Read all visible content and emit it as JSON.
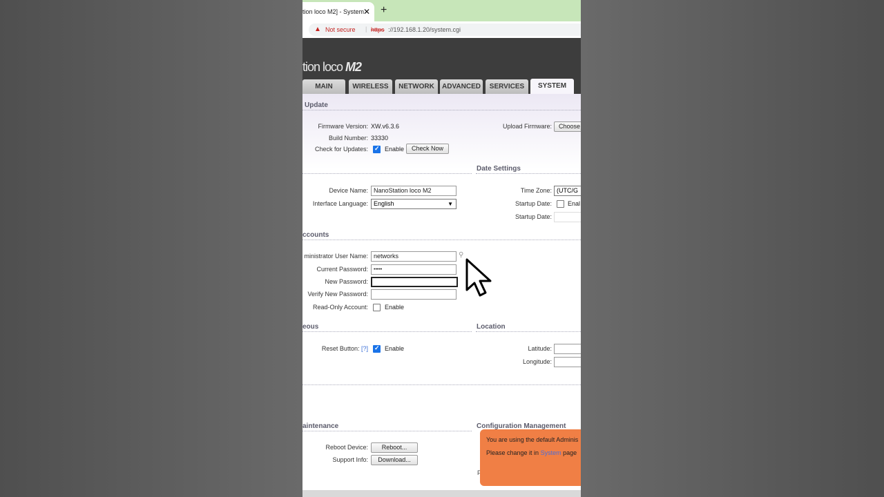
{
  "browser": {
    "tab_title": "tion loco M2] - System",
    "close_glyph": "✕",
    "new_tab_glyph": "+",
    "security_warning": "Not secure",
    "url_scheme": "https",
    "url_rest": "://192.168.1.20/system.cgi"
  },
  "header": {
    "logo_light": "tion loco ",
    "logo_bold": "M2",
    "tabs": [
      {
        "label": "MAIN"
      },
      {
        "label": "WIRELESS"
      },
      {
        "label": "NETWORK"
      },
      {
        "label": "ADVANCED"
      },
      {
        "label": "SERVICES"
      },
      {
        "label": "SYSTEM"
      }
    ]
  },
  "update": {
    "section": "Update",
    "firmware_label": "Firmware Version:",
    "firmware_value": "XW.v6.3.6",
    "build_label": "Build Number:",
    "build_value": "33330",
    "check_label": "Check for Updates:",
    "check_enable": "Enable",
    "check_now": "Check Now",
    "upload_label": "Upload Firmware:",
    "choose_button": "Choose"
  },
  "device": {
    "name_label": "Device Name:",
    "name_value": "NanoStation loco M2",
    "lang_label": "Interface Language:",
    "lang_value": "English"
  },
  "date": {
    "section": "Date Settings",
    "tz_label": "Time Zone:",
    "tz_value": "(UTC/G",
    "startup_label": "Startup Date:",
    "startup_enable": "Enal",
    "startup_date_label": "Startup Date:"
  },
  "accounts": {
    "section": "ccounts",
    "admin_label": "ministrator User Name:",
    "admin_value": "networks",
    "current_pw_label": "Current Password:",
    "current_pw_value": "•••••",
    "new_pw_label": "New Password:",
    "verify_pw_label": "Verify New Password:",
    "readonly_label": "Read-Only Account:",
    "readonly_enable": "Enable"
  },
  "misc": {
    "section": "eous",
    "reset_label": "Reset Button:",
    "reset_help": "[?]",
    "reset_enable": "Enable"
  },
  "location": {
    "section": "Location",
    "lat_label": "Latitude:",
    "lon_label": "Longitude:"
  },
  "maintenance": {
    "section": "aintenance",
    "reboot_label": "Reboot Device:",
    "reboot_button": "Reboot...",
    "support_label": "Support Info:",
    "download_button": "Download..."
  },
  "config": {
    "section": "Configuration Management",
    "partial_label": "F"
  },
  "toast": {
    "line1": "You are using the default Adminis",
    "line2_pre": "Please change it in ",
    "line2_link": "System",
    "line2_post": " page"
  },
  "colors": {
    "tab_strip": "#c7e6b9",
    "header": "#3d3d3d",
    "toast": "#f07f45",
    "checkbox": "#1a73e8"
  }
}
